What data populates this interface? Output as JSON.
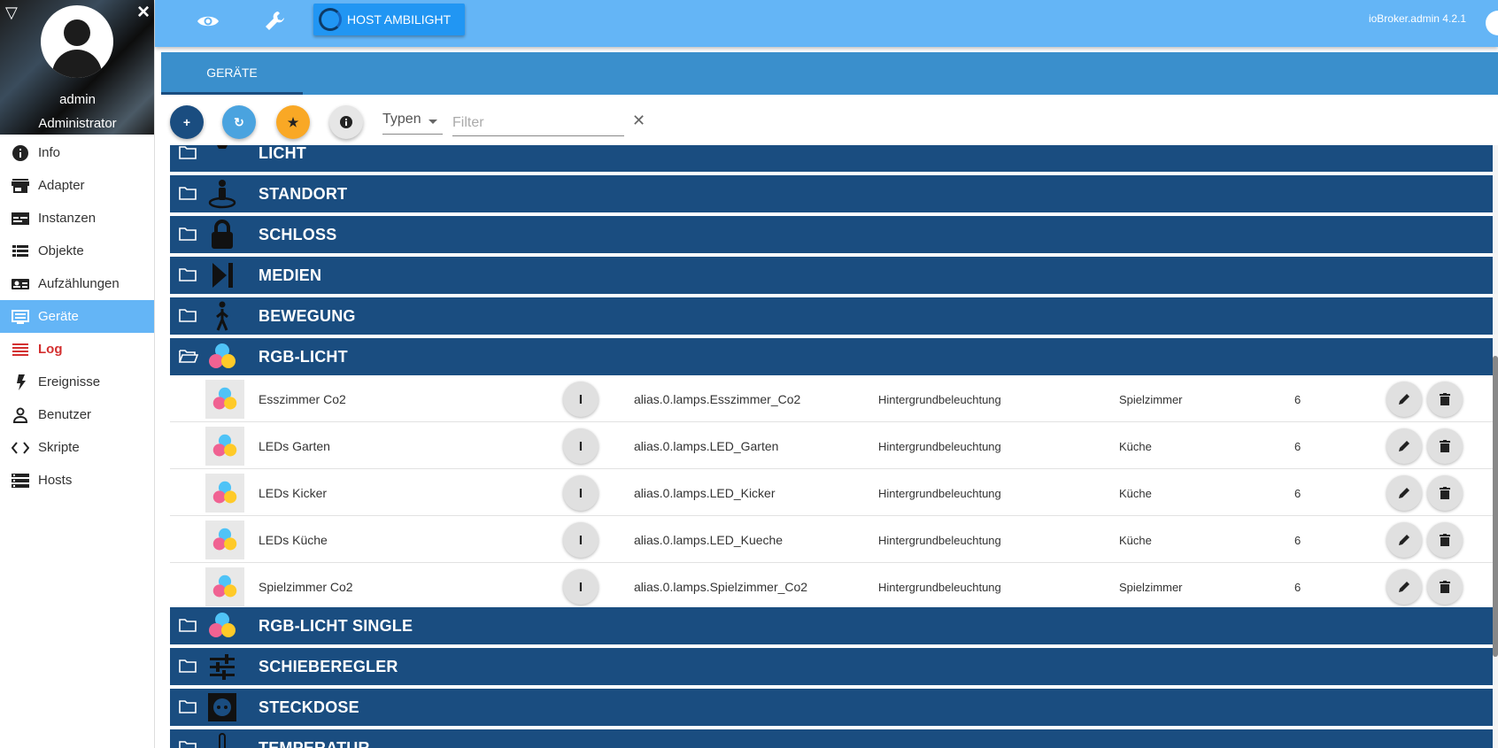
{
  "sidebar": {
    "user": {
      "name": "admin",
      "role": "Administrator"
    },
    "items": [
      {
        "label": "Info",
        "icon": "info-icon"
      },
      {
        "label": "Adapter",
        "icon": "store-icon"
      },
      {
        "label": "Instanzen",
        "icon": "instances-icon"
      },
      {
        "label": "Objekte",
        "icon": "list-icon"
      },
      {
        "label": "Aufzählungen",
        "icon": "id-card-icon"
      },
      {
        "label": "Geräte",
        "icon": "devices-icon",
        "active": true
      },
      {
        "label": "Log",
        "icon": "log-icon"
      },
      {
        "label": "Ereignisse",
        "icon": "flash-icon"
      },
      {
        "label": "Benutzer",
        "icon": "person-icon"
      },
      {
        "label": "Skripte",
        "icon": "code-icon"
      },
      {
        "label": "Hosts",
        "icon": "storage-icon"
      }
    ]
  },
  "topbar": {
    "host_button": "HOST AMBILIGHT",
    "version": "ioBroker.admin 4.2.1"
  },
  "tabs": [
    {
      "label": "GERÄTE",
      "active": true
    }
  ],
  "toolbar": {
    "add": "+",
    "refresh": "↻",
    "star": "★",
    "info": "i",
    "types_label": "Typen",
    "filter_placeholder": "Filter",
    "clear": "✕"
  },
  "categories_top": [
    {
      "label": "LICHT",
      "icon": "bulb-icon"
    },
    {
      "label": "STANDORT",
      "icon": "location-icon"
    },
    {
      "label": "SCHLOSS",
      "icon": "lock-icon"
    },
    {
      "label": "MEDIEN",
      "icon": "media-icon"
    },
    {
      "label": "BEWEGUNG",
      "icon": "walking-icon"
    },
    {
      "label": "RGB-LICHT",
      "icon": "rgb-icon",
      "expanded": true
    }
  ],
  "devices": [
    {
      "name": "Esszimmer Co2",
      "id": "alias.0.lamps.Esszimmer_Co2",
      "function": "Hintergrundbeleuchtung",
      "room": "Spielzimmer",
      "count": "6"
    },
    {
      "name": "LEDs Garten",
      "id": "alias.0.lamps.LED_Garten",
      "function": "Hintergrundbeleuchtung",
      "room": "Küche",
      "count": "6"
    },
    {
      "name": "LEDs Kicker",
      "id": "alias.0.lamps.LED_Kicker",
      "function": "Hintergrundbeleuchtung",
      "room": "Küche",
      "count": "6"
    },
    {
      "name": "LEDs Küche",
      "id": "alias.0.lamps.LED_Kueche",
      "function": "Hintergrundbeleuchtung",
      "room": "Küche",
      "count": "6"
    },
    {
      "name": "Spielzimmer Co2",
      "id": "alias.0.lamps.Spielzimmer_Co2",
      "function": "Hintergrundbeleuchtung",
      "room": "Spielzimmer",
      "count": "6"
    }
  ],
  "categories_bottom": [
    {
      "label": "RGB-LICHT SINGLE",
      "icon": "rgb-icon"
    },
    {
      "label": "SCHIEBEREGLER",
      "icon": "slider-icon"
    },
    {
      "label": "STECKDOSE",
      "icon": "socket-icon"
    },
    {
      "label": "TEMPERATUR",
      "icon": "thermometer-icon"
    }
  ],
  "colors": {
    "sidebar_active": "#64b5f6",
    "topbar": "#64b5f6",
    "category_bar": "#1a4d80",
    "log_red": "#d32f2f",
    "fab_add": "#1a4d80",
    "fab_refresh": "#4aa3df",
    "fab_star": "#f9a825"
  }
}
